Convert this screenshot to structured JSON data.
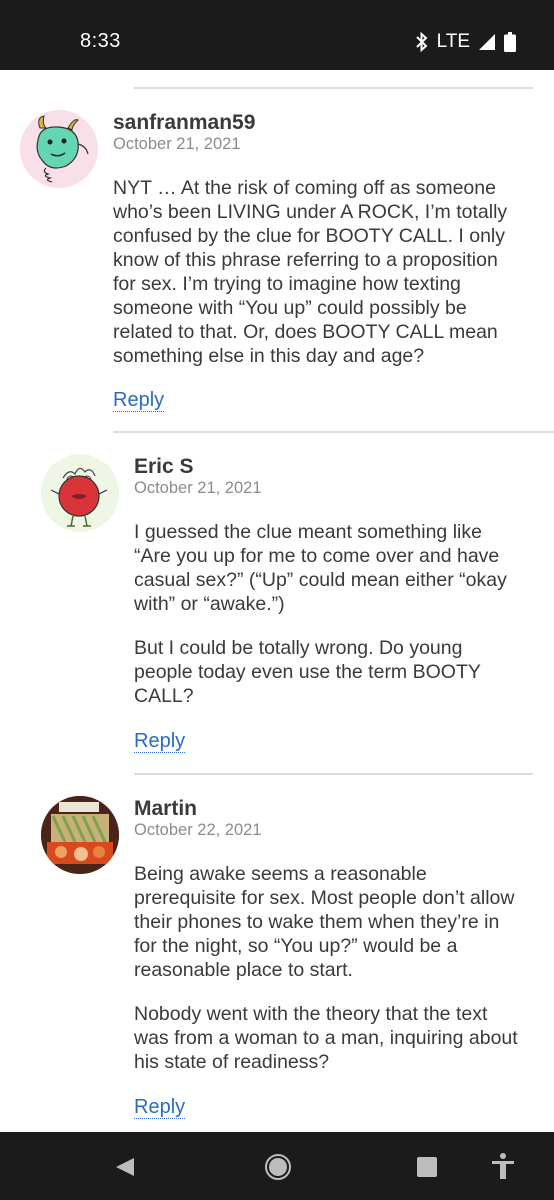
{
  "status": {
    "time": "8:33",
    "network": "LTE",
    "icons": [
      "bluetooth-icon",
      "signal-icon",
      "battery-icon"
    ]
  },
  "comments": [
    {
      "author": "sanfranman59",
      "date": "October 21, 2021",
      "avatar": "monster-avatar",
      "paragraphs": [
        "NYT … At the risk of coming off as someone who’s been LIVING under A ROCK, I’m totally confused by the clue for BOOTY CALL. I only know of this phrase referring to a proposition for sex. I’m trying to imagine how texting someone with “You up” could possibly be related to that. Or, does BOOTY CALL mean something else in this day and age?"
      ],
      "reply_label": "Reply"
    },
    {
      "author": "Eric S",
      "date": "October 21, 2021",
      "avatar": "red-monster-avatar",
      "paragraphs": [
        "I guessed the clue meant something like “Are you up for me to come over and have casual sex?” (“Up” could mean either “okay with” or “awake.”)",
        "But I could be totally wrong. Do young people today even use the term BOOTY CALL?"
      ],
      "reply_label": "Reply"
    },
    {
      "author": "Martin",
      "date": "October 22, 2021",
      "avatar": "food-photo-avatar",
      "paragraphs": [
        "Being awake seems a reasonable prerequisite for sex. Most people don’t allow their phones to wake them when they’re in for the night, so “You up?” would be a reasonable place to start.",
        "Nobody went with the theory that the text was from a woman to a man, inquiring about his state of readiness?"
      ],
      "reply_label": "Reply"
    }
  ],
  "nav": {
    "buttons": [
      "back-icon",
      "home-icon",
      "recents-icon",
      "accessibility-icon"
    ]
  },
  "colors": {
    "link": "#2a6cc5",
    "bars": "#1b1b1b",
    "text": "#3a3a3a",
    "muted": "#8c8c8c"
  }
}
